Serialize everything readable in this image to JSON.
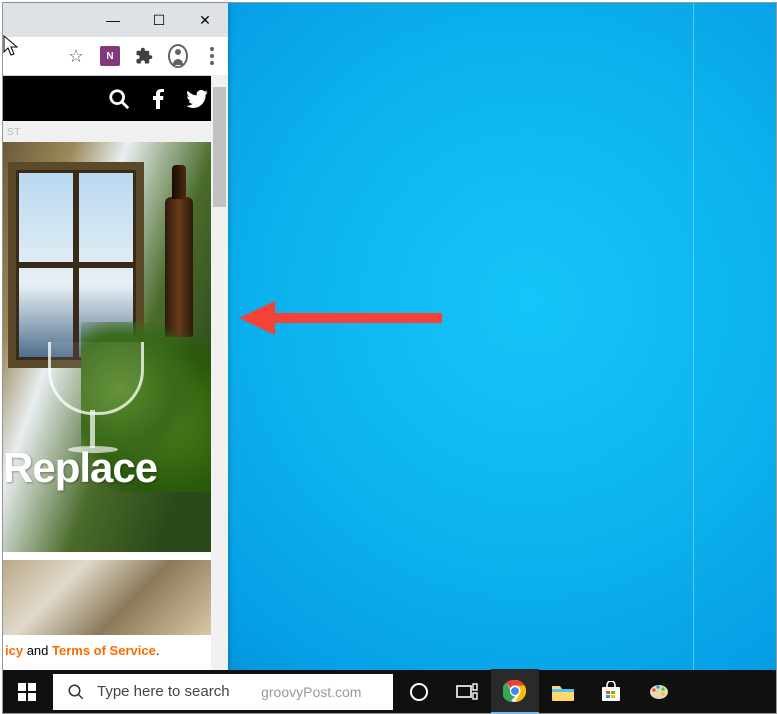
{
  "window_controls": {
    "minimize": "—",
    "maximize": "☐",
    "close": "✕"
  },
  "toolbar": {
    "star_icon": "star-icon",
    "onenote_label": "N",
    "extensions_icon": "puzzle-icon",
    "profile_icon": "avatar-icon",
    "menu_icon": "menu-icon"
  },
  "site_header": {
    "search_icon": "search-icon",
    "facebook_icon": "facebook-icon",
    "twitter_icon": "twitter-icon"
  },
  "breadcrumb_tail": "ST",
  "article": {
    "headline_fragment": "Replace",
    "legal_prefix": "icy",
    "legal_and": " and ",
    "legal_tos": "Terms of Service",
    "legal_period": "."
  },
  "taskbar": {
    "search_placeholder": "Type here to search",
    "watermark": "groovyPost.com",
    "items": {
      "cortana": "cortana-icon",
      "taskview": "taskview-icon",
      "chrome": "chrome-icon",
      "explorer": "explorer-icon",
      "store": "store-icon",
      "paint": "paint-icon"
    }
  },
  "annotation": {
    "arrow": "attention-arrow-left"
  },
  "cursor": "mouse-cursor"
}
